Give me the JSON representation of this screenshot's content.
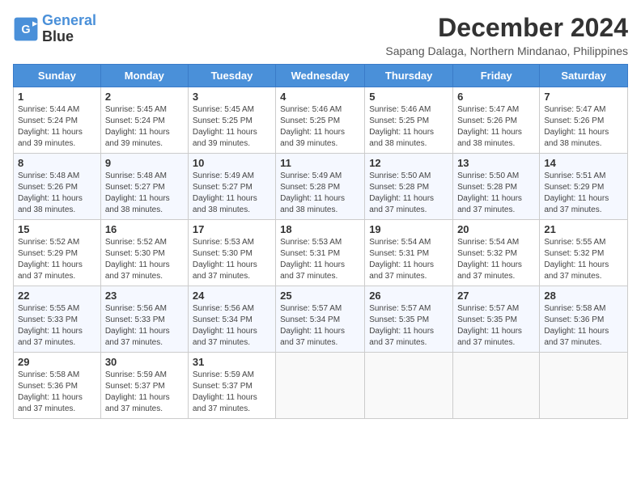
{
  "app": {
    "logo_line1": "General",
    "logo_line2": "Blue"
  },
  "header": {
    "title": "December 2024",
    "location": "Sapang Dalaga, Northern Mindanao, Philippines"
  },
  "days_of_week": [
    "Sunday",
    "Monday",
    "Tuesday",
    "Wednesday",
    "Thursday",
    "Friday",
    "Saturday"
  ],
  "weeks": [
    [
      {
        "day": "1",
        "info": "Sunrise: 5:44 AM\nSunset: 5:24 PM\nDaylight: 11 hours\nand 39 minutes."
      },
      {
        "day": "2",
        "info": "Sunrise: 5:45 AM\nSunset: 5:24 PM\nDaylight: 11 hours\nand 39 minutes."
      },
      {
        "day": "3",
        "info": "Sunrise: 5:45 AM\nSunset: 5:25 PM\nDaylight: 11 hours\nand 39 minutes."
      },
      {
        "day": "4",
        "info": "Sunrise: 5:46 AM\nSunset: 5:25 PM\nDaylight: 11 hours\nand 39 minutes."
      },
      {
        "day": "5",
        "info": "Sunrise: 5:46 AM\nSunset: 5:25 PM\nDaylight: 11 hours\nand 38 minutes."
      },
      {
        "day": "6",
        "info": "Sunrise: 5:47 AM\nSunset: 5:26 PM\nDaylight: 11 hours\nand 38 minutes."
      },
      {
        "day": "7",
        "info": "Sunrise: 5:47 AM\nSunset: 5:26 PM\nDaylight: 11 hours\nand 38 minutes."
      }
    ],
    [
      {
        "day": "8",
        "info": "Sunrise: 5:48 AM\nSunset: 5:26 PM\nDaylight: 11 hours\nand 38 minutes."
      },
      {
        "day": "9",
        "info": "Sunrise: 5:48 AM\nSunset: 5:27 PM\nDaylight: 11 hours\nand 38 minutes."
      },
      {
        "day": "10",
        "info": "Sunrise: 5:49 AM\nSunset: 5:27 PM\nDaylight: 11 hours\nand 38 minutes."
      },
      {
        "day": "11",
        "info": "Sunrise: 5:49 AM\nSunset: 5:28 PM\nDaylight: 11 hours\nand 38 minutes."
      },
      {
        "day": "12",
        "info": "Sunrise: 5:50 AM\nSunset: 5:28 PM\nDaylight: 11 hours\nand 37 minutes."
      },
      {
        "day": "13",
        "info": "Sunrise: 5:50 AM\nSunset: 5:28 PM\nDaylight: 11 hours\nand 37 minutes."
      },
      {
        "day": "14",
        "info": "Sunrise: 5:51 AM\nSunset: 5:29 PM\nDaylight: 11 hours\nand 37 minutes."
      }
    ],
    [
      {
        "day": "15",
        "info": "Sunrise: 5:52 AM\nSunset: 5:29 PM\nDaylight: 11 hours\nand 37 minutes."
      },
      {
        "day": "16",
        "info": "Sunrise: 5:52 AM\nSunset: 5:30 PM\nDaylight: 11 hours\nand 37 minutes."
      },
      {
        "day": "17",
        "info": "Sunrise: 5:53 AM\nSunset: 5:30 PM\nDaylight: 11 hours\nand 37 minutes."
      },
      {
        "day": "18",
        "info": "Sunrise: 5:53 AM\nSunset: 5:31 PM\nDaylight: 11 hours\nand 37 minutes."
      },
      {
        "day": "19",
        "info": "Sunrise: 5:54 AM\nSunset: 5:31 PM\nDaylight: 11 hours\nand 37 minutes."
      },
      {
        "day": "20",
        "info": "Sunrise: 5:54 AM\nSunset: 5:32 PM\nDaylight: 11 hours\nand 37 minutes."
      },
      {
        "day": "21",
        "info": "Sunrise: 5:55 AM\nSunset: 5:32 PM\nDaylight: 11 hours\nand 37 minutes."
      }
    ],
    [
      {
        "day": "22",
        "info": "Sunrise: 5:55 AM\nSunset: 5:33 PM\nDaylight: 11 hours\nand 37 minutes."
      },
      {
        "day": "23",
        "info": "Sunrise: 5:56 AM\nSunset: 5:33 PM\nDaylight: 11 hours\nand 37 minutes."
      },
      {
        "day": "24",
        "info": "Sunrise: 5:56 AM\nSunset: 5:34 PM\nDaylight: 11 hours\nand 37 minutes."
      },
      {
        "day": "25",
        "info": "Sunrise: 5:57 AM\nSunset: 5:34 PM\nDaylight: 11 hours\nand 37 minutes."
      },
      {
        "day": "26",
        "info": "Sunrise: 5:57 AM\nSunset: 5:35 PM\nDaylight: 11 hours\nand 37 minutes."
      },
      {
        "day": "27",
        "info": "Sunrise: 5:57 AM\nSunset: 5:35 PM\nDaylight: 11 hours\nand 37 minutes."
      },
      {
        "day": "28",
        "info": "Sunrise: 5:58 AM\nSunset: 5:36 PM\nDaylight: 11 hours\nand 37 minutes."
      }
    ],
    [
      {
        "day": "29",
        "info": "Sunrise: 5:58 AM\nSunset: 5:36 PM\nDaylight: 11 hours\nand 37 minutes."
      },
      {
        "day": "30",
        "info": "Sunrise: 5:59 AM\nSunset: 5:37 PM\nDaylight: 11 hours\nand 37 minutes."
      },
      {
        "day": "31",
        "info": "Sunrise: 5:59 AM\nSunset: 5:37 PM\nDaylight: 11 hours\nand 37 minutes."
      },
      {
        "day": "",
        "info": ""
      },
      {
        "day": "",
        "info": ""
      },
      {
        "day": "",
        "info": ""
      },
      {
        "day": "",
        "info": ""
      }
    ]
  ]
}
